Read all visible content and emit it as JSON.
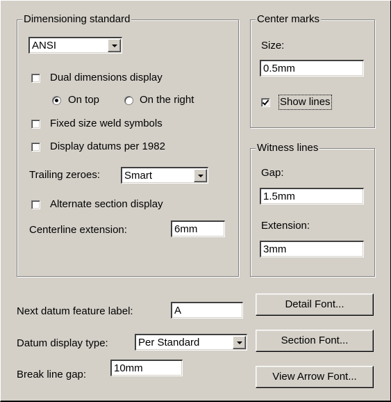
{
  "dimensioning": {
    "legend": "Dimensioning standard",
    "standard_value": "ANSI",
    "dual_dimensions_label": "Dual dimensions display",
    "on_top_label": "On top",
    "on_right_label": "On the right",
    "fixed_weld_label": "Fixed size weld symbols",
    "datums_1982_label": "Display datums per 1982",
    "trailing_zeroes_label": "Trailing zeroes:",
    "trailing_zeroes_value": "Smart",
    "alternate_section_label": "Alternate section display",
    "centerline_ext_label": "Centerline extension:",
    "centerline_ext_value": "6mm"
  },
  "center_marks": {
    "legend": "Center marks",
    "size_label": "Size:",
    "size_value": "0.5mm",
    "show_lines_label": "Show lines",
    "show_lines_checked": true
  },
  "witness_lines": {
    "legend": "Witness lines",
    "gap_label": "Gap:",
    "gap_value": "1.5mm",
    "extension_label": "Extension:",
    "extension_value": "3mm"
  },
  "bottom": {
    "next_datum_label": "Next datum feature label:",
    "next_datum_value": "A",
    "datum_display_label": "Datum display type:",
    "datum_display_value": "Per Standard",
    "break_gap_label": "Break line gap:",
    "break_gap_value": "10mm"
  },
  "buttons": {
    "detail_font": "Detail Font...",
    "section_font": "Section Font...",
    "view_arrow_font": "View Arrow Font..."
  },
  "options": {
    "dual_dimensions": false,
    "on_top": true,
    "on_right": false,
    "fixed_weld": false,
    "datums_1982": false,
    "alternate_section": false
  }
}
